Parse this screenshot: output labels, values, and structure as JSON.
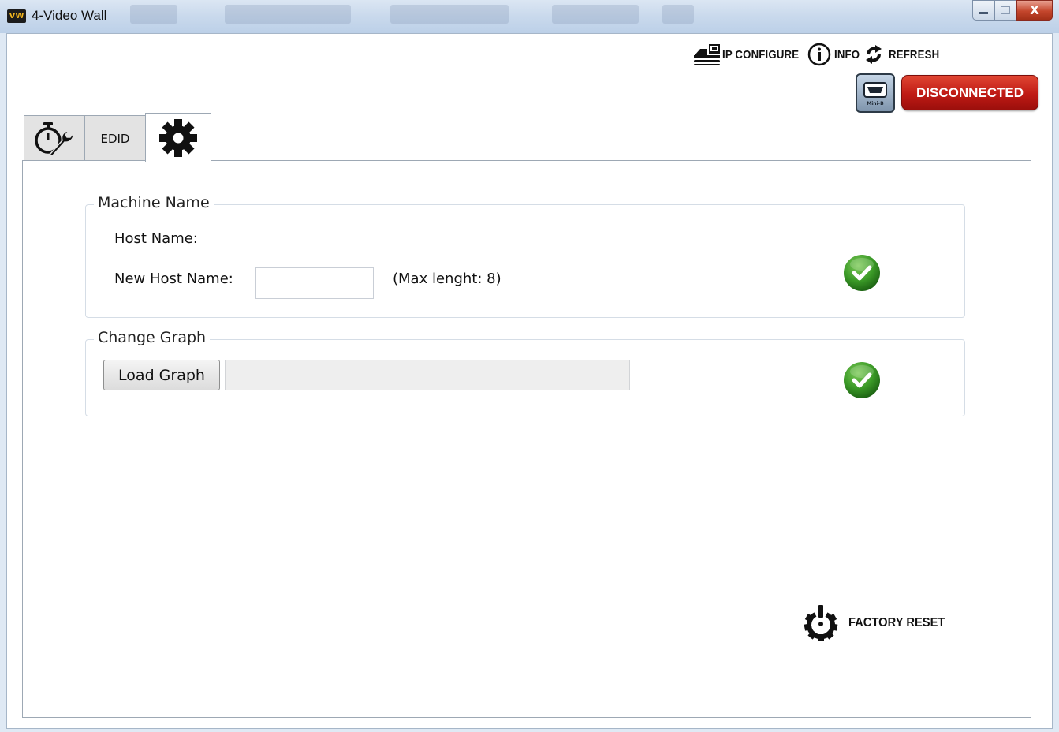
{
  "window": {
    "title": "4-Video Wall",
    "logo_text": "VW"
  },
  "window_controls": {
    "close_symbol": "X"
  },
  "top_actions": [
    {
      "label": "IP CONFIGURE",
      "icon": "network-config-icon"
    },
    {
      "label": "INFO",
      "icon": "info-circle-icon"
    },
    {
      "label": "REFRESH",
      "icon": "refresh-icon"
    }
  ],
  "connection": {
    "status_label": "DISCONNECTED",
    "status_color": "#c41b15",
    "usb_label": "Mini-B"
  },
  "tabs": [
    {
      "label": "",
      "icon": "timer-wrench-icon"
    },
    {
      "label": "EDID"
    },
    {
      "label": "",
      "icon": "gear-icon",
      "active": true
    }
  ],
  "machine_name": {
    "legend": "Machine Name",
    "host_name_label": "Host Name:",
    "host_name_value": "",
    "new_host_name_label": "New Host Name:",
    "new_host_name_value": "",
    "max_length_note": "(Max lenght: 8)"
  },
  "change_graph": {
    "legend": "Change Graph",
    "load_button_label": "Load Graph",
    "file_path_value": ""
  },
  "factory_reset": {
    "label": "FACTORY RESET"
  },
  "colors": {
    "confirm_green": "#3f9a2b",
    "disconnected_red": "#c41b15"
  }
}
